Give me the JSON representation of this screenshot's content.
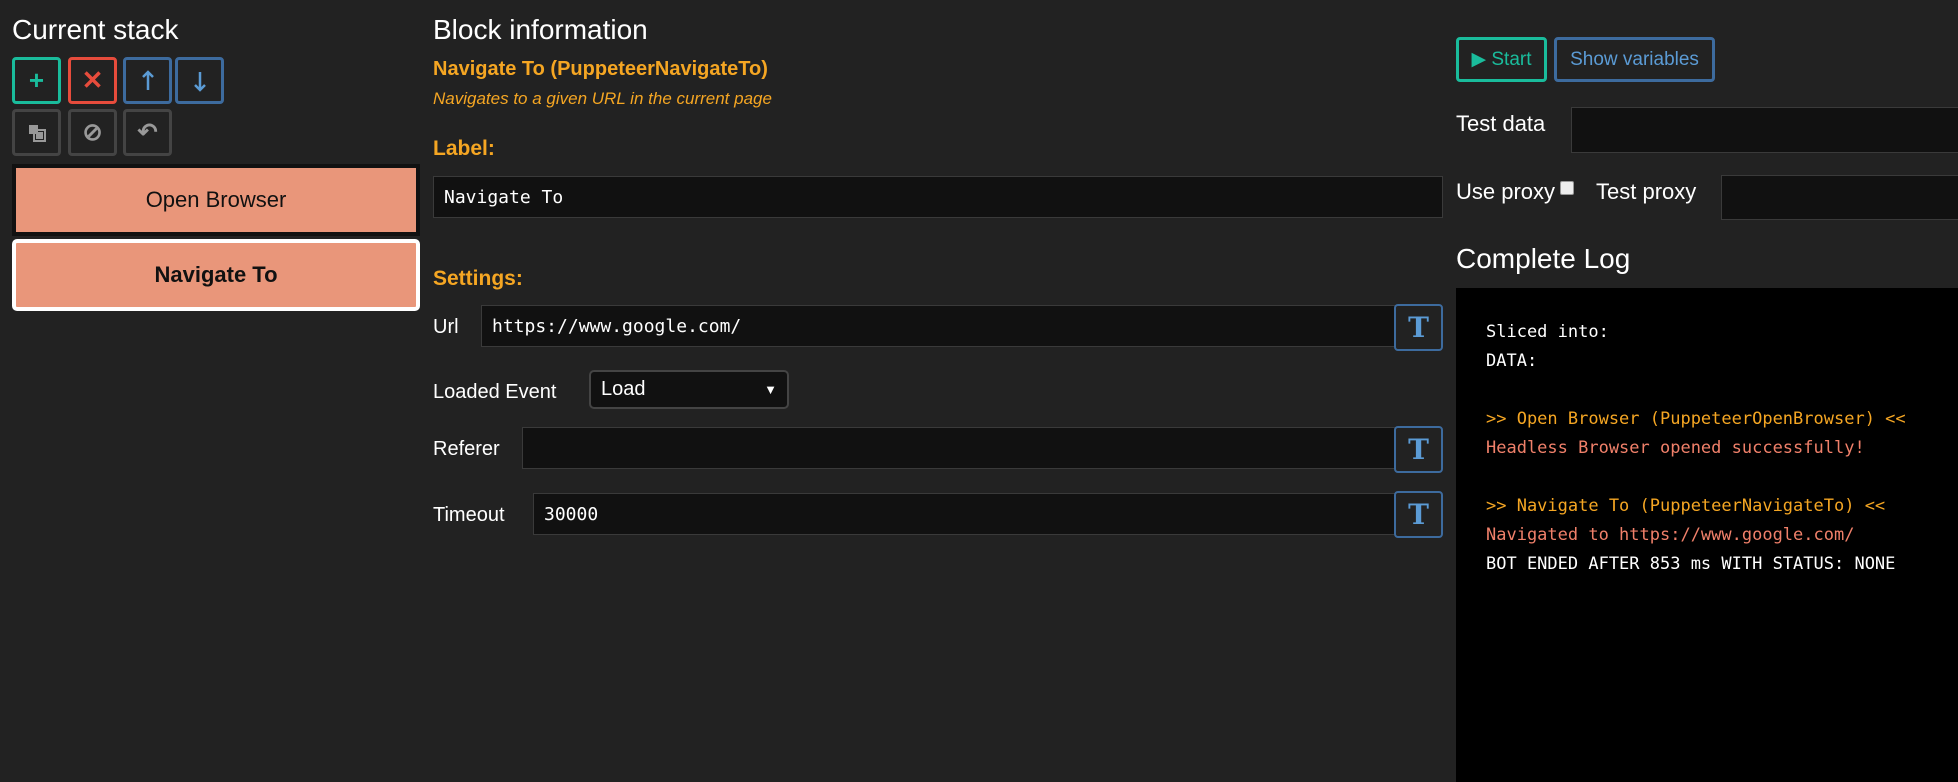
{
  "stack": {
    "title": "Current stack",
    "buttons": {
      "add": "+",
      "delete": "✕",
      "up": "🡑",
      "down": "🡓",
      "clone": "⧉",
      "disable": "⊘",
      "undo": "↶"
    },
    "blocks": [
      {
        "label": "Open Browser",
        "selected": false
      },
      {
        "label": "Navigate To",
        "selected": true
      }
    ]
  },
  "info": {
    "title": "Block information",
    "block_name": "Navigate To (PuppeteerNavigateTo)",
    "block_description": "Navigates to a given URL in the current page",
    "label_heading": "Label:",
    "label_value": "Navigate To",
    "settings_heading": "Settings:",
    "fields": {
      "url": {
        "label": "Url",
        "value": "https://www.google.com/"
      },
      "loaded_event": {
        "label": "Loaded Event",
        "value": "Load"
      },
      "referer": {
        "label": "Referer",
        "value": ""
      },
      "timeout": {
        "label": "Timeout",
        "value": "30000"
      }
    },
    "type_toggle_label": "T"
  },
  "debugger": {
    "start_label": "▶ Start",
    "show_variables_label": "Show variables",
    "test_data_label": "Test data",
    "use_proxy_label": "Use proxy",
    "test_proxy_label": "Test proxy",
    "log_title": "Complete Log",
    "log_lines": [
      {
        "text": "Sliced into:",
        "color": "#ffffff"
      },
      {
        "text": "DATA:",
        "color": "#ffffff"
      },
      {
        "text": "",
        "color": "#ffffff"
      },
      {
        "text": ">> Open Browser (PuppeteerOpenBrowser) <<",
        "color": "#f5a623"
      },
      {
        "text": "Headless Browser opened successfully!",
        "color": "#f0806a"
      },
      {
        "text": "",
        "color": "#ffffff"
      },
      {
        "text": ">> Navigate To (PuppeteerNavigateTo) <<",
        "color": "#f5a623"
      },
      {
        "text": "Navigated to https://www.google.com/",
        "color": "#f0806a"
      },
      {
        "text": "BOT ENDED AFTER 853 ms WITH STATUS: NONE",
        "color": "#ffffff"
      }
    ]
  },
  "colors": {
    "background": "#222222",
    "accent_orange": "#f5a623",
    "block_salmon": "#e9967a",
    "success_teal": "#1abc9c",
    "danger_red": "#e74c3c",
    "info_blue": "#5b9bd5"
  }
}
